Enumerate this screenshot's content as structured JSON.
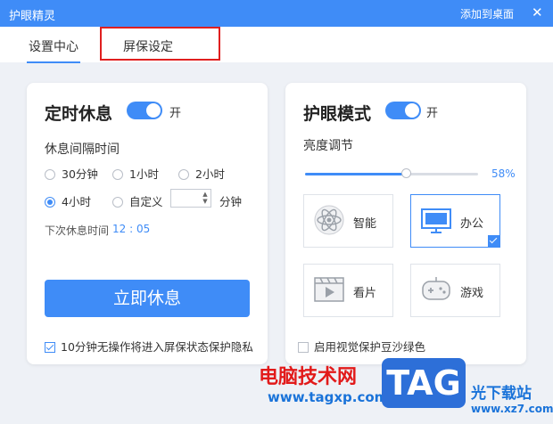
{
  "window": {
    "title": "护眼精灵",
    "add_to_desktop": "添加到桌面",
    "close_glyph": "✕"
  },
  "tabs": [
    {
      "label": "设置中心",
      "active": true
    },
    {
      "label": "屏保设定",
      "active": false
    }
  ],
  "rest_card": {
    "title": "定时休息",
    "toggle_label": "开",
    "toggle_on": true,
    "interval_label": "休息间隔时间",
    "options": [
      {
        "label": "30分钟",
        "checked": false
      },
      {
        "label": "1小时",
        "checked": false
      },
      {
        "label": "2小时",
        "checked": false
      },
      {
        "label": "4小时",
        "checked": true
      },
      {
        "label": "自定义",
        "checked": false
      }
    ],
    "custom_value": "",
    "custom_unit": "分钟",
    "next_rest_label": "下次休息时间",
    "next_rest_time": "12 : 05",
    "rest_now_button": "立即休息",
    "screensaver_privacy": {
      "label": "10分钟无操作将进入屏保状态保护隐私",
      "checked": true
    }
  },
  "eye_card": {
    "title": "护眼模式",
    "toggle_label": "开",
    "toggle_on": true,
    "brightness_label": "亮度调节",
    "brightness_value": "58%",
    "brightness_fraction": 0.58,
    "modes": [
      {
        "label": "智能",
        "icon": "atom-icon",
        "selected": false
      },
      {
        "label": "办公",
        "icon": "monitor-icon",
        "selected": true
      },
      {
        "label": "看片",
        "icon": "film-icon",
        "selected": false
      },
      {
        "label": "游戏",
        "icon": "gamepad-icon",
        "selected": false
      }
    ],
    "bean_green": {
      "label": "启用视觉保护豆沙绿色",
      "checked": false
    }
  },
  "watermark": {
    "left_text": "电脑技术网",
    "url": "www.tagxp.com",
    "tag": "TAG",
    "right_text": "光下载站",
    "right_url": "www.xz7.com"
  },
  "colors": {
    "accent": "#3f8cf7",
    "highlight": "#e01f1f",
    "watermark_red": "#e21a1a"
  }
}
